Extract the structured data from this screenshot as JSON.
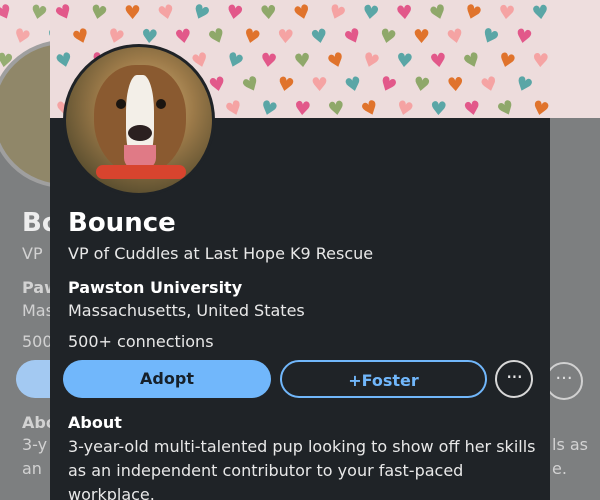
{
  "profile": {
    "name": "Bounce",
    "headline": "VP of Cuddles at Last Hope K9 Rescue",
    "school": "Pawston University",
    "location": "Massachusetts, United States",
    "connections": "500+ connections"
  },
  "actions": {
    "adopt_label": "Adopt",
    "foster_label": "+Foster",
    "more_label": "···"
  },
  "about": {
    "title": "About",
    "text": "3-year-old multi-talented pup looking to show off her skills as an independent contributor to your fast-paced workplace."
  },
  "background": {
    "name_partial": "Bo",
    "line1_partial": "VP",
    "line2_partial": "Paw",
    "line3_partial": "Mas",
    "line4_partial": "500",
    "about_partial": "Abo",
    "text1_left": "3-y",
    "text2_left": "an",
    "text1_right": "ls as",
    "text2_right": "e."
  },
  "colors": {
    "accent": "#71b7fb",
    "card_bg": "#1f2327",
    "banner_bg": "#eddcdc",
    "hearts": [
      "#e2588a",
      "#e0732c",
      "#5aa6a6",
      "#8fa86a",
      "#f5a3a3"
    ]
  },
  "icons": {
    "heart": "heart-icon",
    "more": "more-options-icon"
  }
}
